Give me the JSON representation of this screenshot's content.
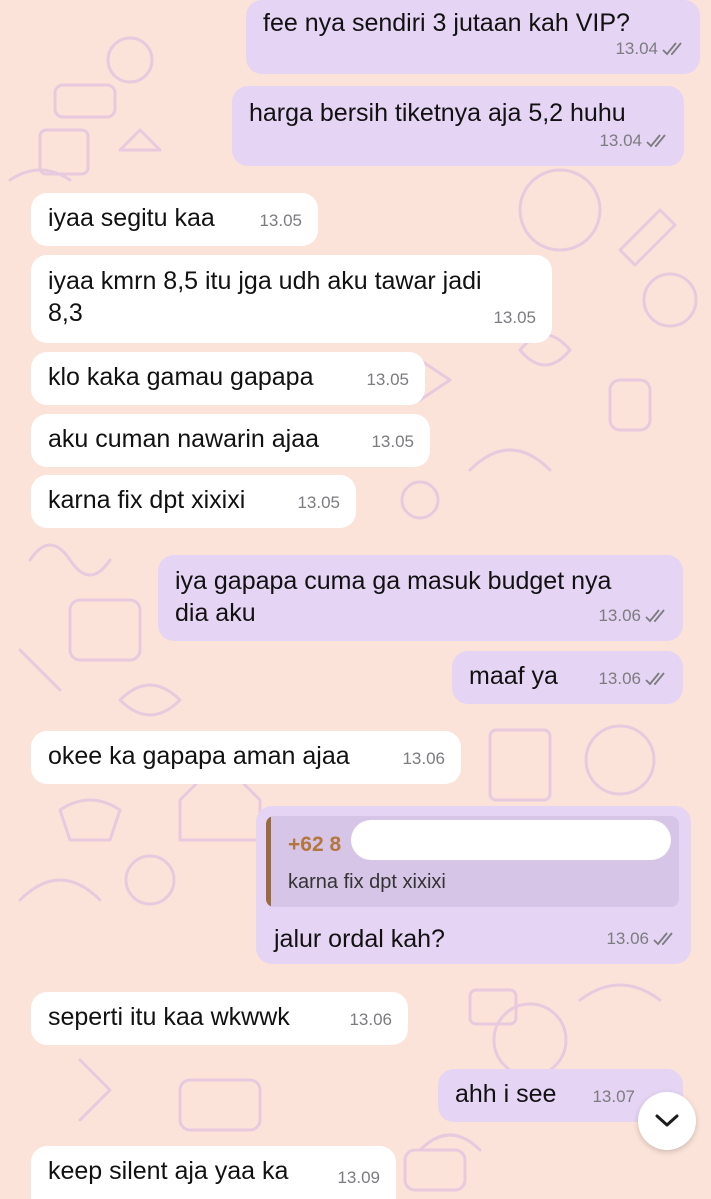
{
  "chat": {
    "messages": [
      {
        "text": "fee nya sendiri 3 jutaan kah VIP?",
        "time": "13.04"
      },
      {
        "text": "harga bersih tiketnya aja 5,2 huhu",
        "time": "13.04"
      },
      {
        "text": "iyaa segitu kaa",
        "time": "13.05"
      },
      {
        "text": "iyaa kmrn 8,5 itu jga udh aku tawar jadi\n8,3",
        "time": "13.05"
      },
      {
        "text": "klo kaka gamau gapapa",
        "time": "13.05"
      },
      {
        "text": "aku cuman nawarin ajaa",
        "time": "13.05"
      },
      {
        "text": "karna fix dpt xixixi",
        "time": "13.05"
      },
      {
        "text": "iya gapapa cuma ga masuk budget nya\ndia aku",
        "time": "13.06"
      },
      {
        "text": "maaf ya",
        "time": "13.06"
      },
      {
        "text": "okee ka gapapa aman ajaa",
        "time": "13.06"
      },
      {
        "text": "jalur ordal kah?",
        "time": "13.06",
        "reply": {
          "sender": "+62 8",
          "text": "karna fix dpt xixixi"
        }
      },
      {
        "text": "seperti itu kaa wkwwk",
        "time": "13.06"
      },
      {
        "text": "ahh i see",
        "time": "13.07"
      },
      {
        "text": "keep silent aja yaa ka",
        "time": "13.09"
      }
    ]
  },
  "icons": {
    "read_receipt": "double-check-icon",
    "scroll": "chevron-down-icon"
  },
  "colors": {
    "background": "#fbe3d9",
    "incoming": "#ffffff",
    "outgoing": "#e5d4f4",
    "pattern": "#e7c9df",
    "reply_name": "#b4763f"
  }
}
